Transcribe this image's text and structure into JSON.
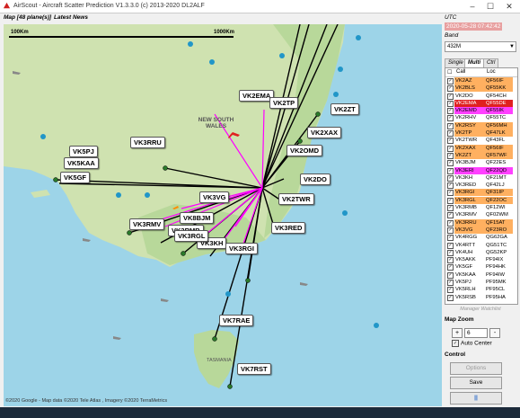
{
  "window": {
    "title": "AirScout - Aircraft Scatter Prediction V1.3.3.0 (c) 2013-2020 DL2ALF"
  },
  "menu": {
    "map_tab": "Map [48 plane(s)]",
    "news_tab": "Latest News"
  },
  "map": {
    "scale_left": "100Km",
    "scale_right": "1000Km",
    "copyright": "©2020 Google - Map data ©2020 Tele Atlas , Imagery ©2020 TerraMetrics",
    "region_label": "NEW SOUTH WALES",
    "tasmania_label": "TASMANIA",
    "callouts": [
      "VK2EMA",
      "VK2TP",
      "VK2ZT",
      "VK5PJ",
      "VK3RRU",
      "VK2XAX",
      "VK5KAA",
      "VK2OMD",
      "VK5GF",
      "VK2DO",
      "VK3VG",
      "VK2TWR",
      "VK3RMV",
      "VK8BJM",
      "VK3RMB",
      "VK3RED",
      "VK3KH",
      "VK3RGL",
      "VK3RGI",
      "VK7RAE",
      "VK7RST"
    ]
  },
  "panel": {
    "utc_label": "UTC",
    "utc_value": "2020-05-28 07:42:42",
    "band_label": "Band",
    "band_value": "432M",
    "tabs": [
      "Single",
      "Multi",
      "Ctrl"
    ],
    "list_header_call": "Call",
    "list_header_loc": "Loc",
    "manager_label": "Manager Watchlist",
    "zoom_label": "Map Zoom",
    "zoom_plus": "+",
    "zoom_minus": "-",
    "zoom_value": "6",
    "auto_center": "Auto Center",
    "control_label": "Control",
    "options_btn": "Options",
    "save_btn": "Save",
    "pause_btn": "||"
  },
  "watchlist": [
    {
      "call": "VK2AZ",
      "loc": "QF56IF",
      "bg": "#ffb060"
    },
    {
      "call": "VK2BLS",
      "loc": "QF55KK",
      "bg": "#ffb060"
    },
    {
      "call": "VK2DO",
      "loc": "QF54CH",
      "bg": "#ffffff"
    },
    {
      "call": "VK2EMA",
      "loc": "QF55DE",
      "bg": "#e02020"
    },
    {
      "call": "VK2EMD",
      "loc": "QF55IK",
      "bg": "#ff40ff"
    },
    {
      "call": "VK2RHV",
      "loc": "QF55TC",
      "bg": "#ffffff"
    },
    {
      "call": "VK2RSY",
      "loc": "QF56MH",
      "bg": "#ffb060"
    },
    {
      "call": "VK2TP",
      "loc": "QF47LK",
      "bg": "#ffb060"
    },
    {
      "call": "VK2TWR",
      "loc": "QF43FL",
      "bg": "#ffffff"
    },
    {
      "call": "VK2XAX",
      "loc": "QF56IF",
      "bg": "#ffb060"
    },
    {
      "call": "VK2ZT",
      "loc": "QF57WF",
      "bg": "#ffb060"
    },
    {
      "call": "VK3BJM",
      "loc": "QF22ES",
      "bg": "#ffffff"
    },
    {
      "call": "VK3ERI",
      "loc": "QF22QD",
      "bg": "#ff40ff"
    },
    {
      "call": "VK3KH",
      "loc": "QF21MT",
      "bg": "#ffffff"
    },
    {
      "call": "VK3RED",
      "loc": "QF42LJ",
      "bg": "#ffffff"
    },
    {
      "call": "VK3RGI",
      "loc": "QF31IP",
      "bg": "#ffb060"
    },
    {
      "call": "VK3RGL",
      "loc": "QF22OC",
      "bg": "#ffb060"
    },
    {
      "call": "VK3RMB",
      "loc": "QF12WI",
      "bg": "#ffffff"
    },
    {
      "call": "VK3RMV",
      "loc": "QF02WM",
      "bg": "#ffffff"
    },
    {
      "call": "VK3RRU",
      "loc": "QF15AT",
      "bg": "#ffb060"
    },
    {
      "call": "VK3VG",
      "loc": "QF23RO",
      "bg": "#ffb060"
    },
    {
      "call": "VK4RGG",
      "loc": "QG62GA",
      "bg": "#ffffff"
    },
    {
      "call": "VK4RTT",
      "loc": "QG51TC",
      "bg": "#ffffff"
    },
    {
      "call": "VK4UH",
      "loc": "QG52KP",
      "bg": "#ffffff"
    },
    {
      "call": "VK5AKK",
      "loc": "PF94IX",
      "bg": "#ffffff"
    },
    {
      "call": "VK5GF",
      "loc": "PF94HK",
      "bg": "#ffffff"
    },
    {
      "call": "VK5KAA",
      "loc": "PF94IW",
      "bg": "#ffffff"
    },
    {
      "call": "VK5PJ",
      "loc": "PF95MK",
      "bg": "#ffffff"
    },
    {
      "call": "VK5RLH",
      "loc": "PF95CL",
      "bg": "#ffffff"
    },
    {
      "call": "VK5RSB",
      "loc": "PF95HA",
      "bg": "#ffffff"
    }
  ],
  "colors": {
    "sea": "#9dd4e8",
    "land": "#cfe2b0",
    "land_green": "#b8d89a",
    "path_black": "#000000",
    "path_magenta": "#ff00ff",
    "utc_bg": "#e8a0a0"
  }
}
